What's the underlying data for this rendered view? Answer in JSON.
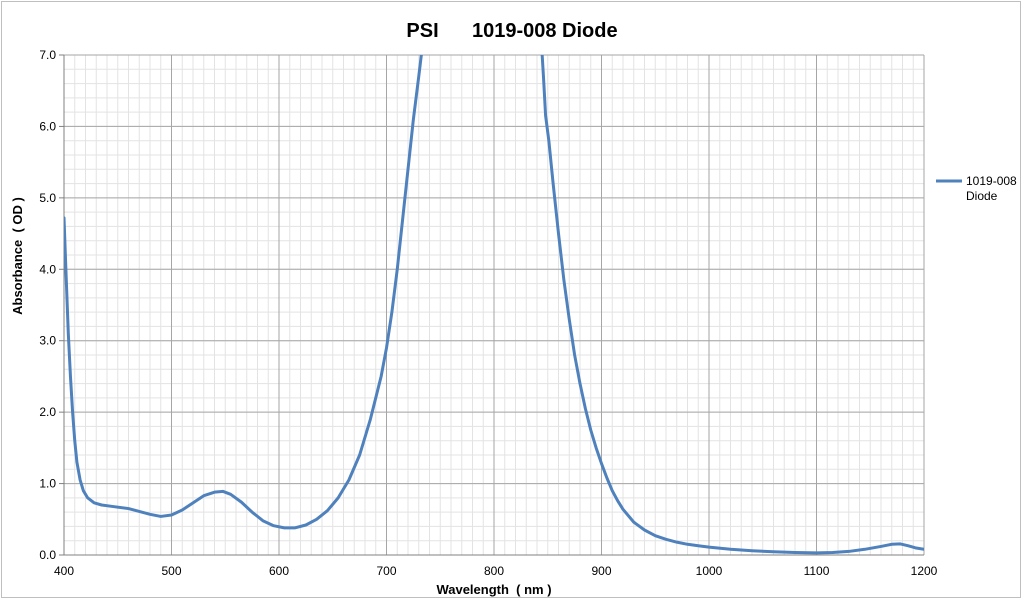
{
  "chart_data": {
    "type": "line",
    "title": "PSI      1019-008 Diode",
    "xlabel": "Wavelength  ( nm )",
    "ylabel": "Absorbance  ( OD )",
    "xlim": [
      400,
      1200
    ],
    "ylim": [
      0,
      7
    ],
    "x_ticks": [
      "400",
      "500",
      "600",
      "700",
      "800",
      "900",
      "1000",
      "1100",
      "1200"
    ],
    "y_ticks": [
      "0.0",
      "1.0",
      "2.0",
      "3.0",
      "4.0",
      "5.0",
      "6.0",
      "7.0"
    ],
    "x_minor_step": 10,
    "y_minor_step": 0.2,
    "grid": true,
    "legend_position": "right",
    "series": [
      {
        "name": "1019-008 Diode",
        "color": "#4f81bd",
        "points": [
          [
            400,
            4.72
          ],
          [
            402,
            3.9
          ],
          [
            404,
            3.1
          ],
          [
            406,
            2.5
          ],
          [
            408,
            2.0
          ],
          [
            410,
            1.6
          ],
          [
            412,
            1.3
          ],
          [
            415,
            1.05
          ],
          [
            418,
            0.9
          ],
          [
            422,
            0.8
          ],
          [
            428,
            0.73
          ],
          [
            435,
            0.7
          ],
          [
            445,
            0.68
          ],
          [
            460,
            0.65
          ],
          [
            470,
            0.61
          ],
          [
            480,
            0.57
          ],
          [
            490,
            0.54
          ],
          [
            500,
            0.56
          ],
          [
            510,
            0.63
          ],
          [
            520,
            0.73
          ],
          [
            530,
            0.83
          ],
          [
            540,
            0.88
          ],
          [
            548,
            0.89
          ],
          [
            555,
            0.85
          ],
          [
            565,
            0.74
          ],
          [
            575,
            0.6
          ],
          [
            585,
            0.48
          ],
          [
            595,
            0.41
          ],
          [
            605,
            0.38
          ],
          [
            615,
            0.38
          ],
          [
            625,
            0.42
          ],
          [
            635,
            0.5
          ],
          [
            645,
            0.62
          ],
          [
            655,
            0.8
          ],
          [
            665,
            1.05
          ],
          [
            675,
            1.4
          ],
          [
            685,
            1.9
          ],
          [
            695,
            2.5
          ],
          [
            700,
            2.9
          ],
          [
            705,
            3.4
          ],
          [
            710,
            4.0
          ],
          [
            715,
            4.7
          ],
          [
            720,
            5.4
          ],
          [
            725,
            6.1
          ],
          [
            730,
            6.7
          ],
          [
            734,
            7.2
          ],
          null,
          [
            844,
            7.2
          ],
          [
            846,
            6.7
          ],
          [
            848,
            6.15
          ],
          [
            851,
            5.8
          ],
          [
            855,
            5.2
          ],
          [
            860,
            4.5
          ],
          [
            865,
            3.85
          ],
          [
            870,
            3.3
          ],
          [
            875,
            2.8
          ],
          [
            880,
            2.4
          ],
          [
            885,
            2.05
          ],
          [
            890,
            1.75
          ],
          [
            895,
            1.5
          ],
          [
            900,
            1.28
          ],
          [
            905,
            1.08
          ],
          [
            910,
            0.9
          ],
          [
            915,
            0.76
          ],
          [
            920,
            0.64
          ],
          [
            930,
            0.46
          ],
          [
            940,
            0.35
          ],
          [
            950,
            0.27
          ],
          [
            960,
            0.22
          ],
          [
            970,
            0.18
          ],
          [
            980,
            0.15
          ],
          [
            990,
            0.13
          ],
          [
            1000,
            0.11
          ],
          [
            1020,
            0.08
          ],
          [
            1040,
            0.06
          ],
          [
            1060,
            0.045
          ],
          [
            1080,
            0.035
          ],
          [
            1100,
            0.03
          ],
          [
            1115,
            0.035
          ],
          [
            1130,
            0.05
          ],
          [
            1145,
            0.08
          ],
          [
            1160,
            0.12
          ],
          [
            1170,
            0.15
          ],
          [
            1178,
            0.155
          ],
          [
            1185,
            0.13
          ],
          [
            1192,
            0.1
          ],
          [
            1200,
            0.08
          ]
        ]
      }
    ]
  }
}
